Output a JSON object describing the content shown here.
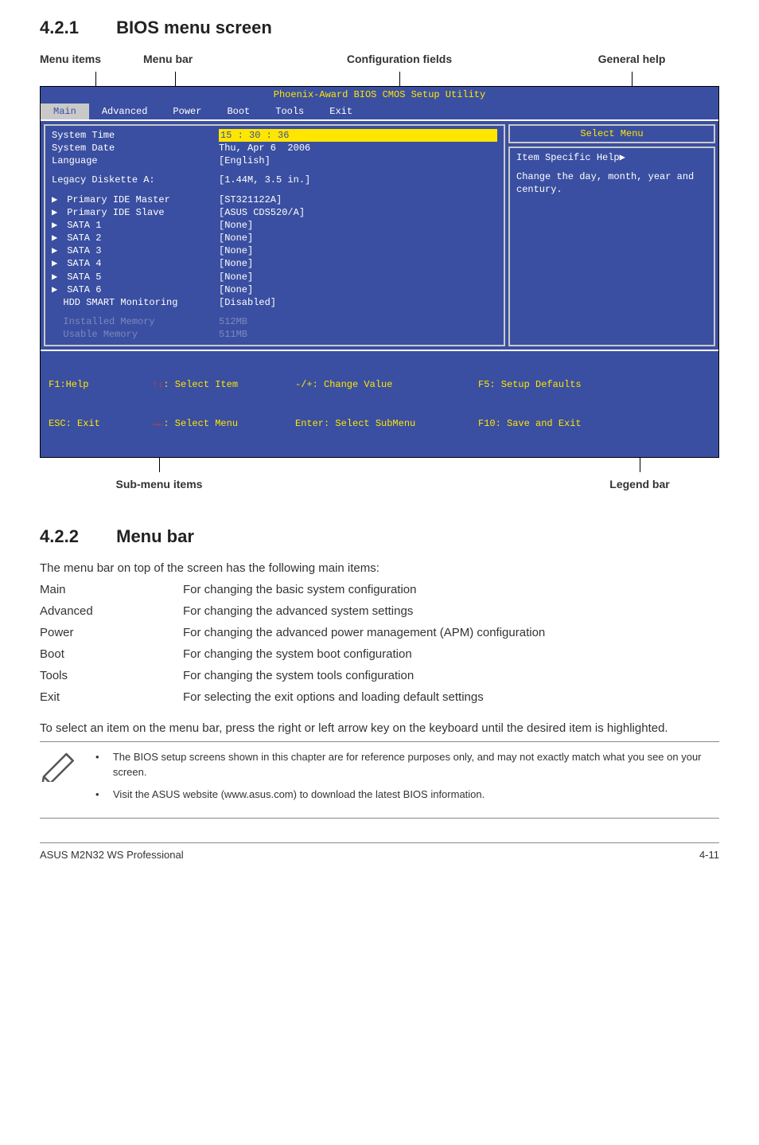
{
  "section_421": {
    "num": "4.2.1",
    "title": "BIOS menu screen"
  },
  "anno": {
    "top": {
      "menu_items": "Menu items",
      "menu_bar": "Menu bar",
      "config_fields": "Configuration fields",
      "general_help": "General help"
    },
    "bottom": {
      "sub_menu": "Sub-menu items",
      "legend": "Legend bar"
    }
  },
  "bios": {
    "title": "Phoenix-Award BIOS CMOS Setup Utility",
    "tabs": [
      "Main",
      "Advanced",
      "Power",
      "Boot",
      "Tools",
      "Exit"
    ],
    "active_tab": "Main",
    "right_title": "Select Menu",
    "right_help_label": "Item Specific Help",
    "right_help_text": "Change the day, month, year and century.",
    "fields": {
      "system_time": {
        "label": "System Time",
        "value": "15 : 30 : 36"
      },
      "system_date": {
        "label": "System Date",
        "value": "Thu, Apr 6  2006"
      },
      "language": {
        "label": "Language",
        "value": "[English]"
      },
      "legacy_diskette": {
        "label": "Legacy Diskette A:",
        "value": "[1.44M, 3.5 in.]"
      },
      "pri_master": {
        "label": "Primary IDE Master",
        "value": "[ST321122A]"
      },
      "pri_slave": {
        "label": "Primary IDE Slave",
        "value": "[ASUS CDS520/A]"
      },
      "sata1": {
        "label": "SATA 1",
        "value": "[None]"
      },
      "sata2": {
        "label": "SATA 2",
        "value": "[None]"
      },
      "sata3": {
        "label": "SATA 3",
        "value": "[None]"
      },
      "sata4": {
        "label": "SATA 4",
        "value": "[None]"
      },
      "sata5": {
        "label": "SATA 5",
        "value": "[None]"
      },
      "sata6": {
        "label": "SATA 6",
        "value": "[None]"
      },
      "hdd_smart": {
        "label": "HDD SMART Monitoring",
        "value": "[Disabled]"
      },
      "installed_mem": {
        "label": "Installed Memory",
        "value": "512MB"
      },
      "usable_mem": {
        "label": "Usable Memory",
        "value": "511MB"
      }
    },
    "footer": {
      "f1": "F1:Help",
      "esc": "ESC: Exit",
      "sel_item": ": Select Item",
      "sel_menu": ": Select Menu",
      "change": "-/+: Change Value",
      "enter": "Enter: Select SubMenu",
      "f5": "F5: Setup Defaults",
      "f10": "F10: Save and Exit"
    }
  },
  "section_422": {
    "num": "4.2.2",
    "title": "Menu bar",
    "intro": "The menu bar on top of the screen has the following main items:",
    "rows": [
      {
        "label": "Main",
        "val": "For changing the basic system configuration"
      },
      {
        "label": "Advanced",
        "val": "For changing the advanced system settings"
      },
      {
        "label": "Power",
        "val": "For changing the advanced power management (APM) configuration"
      },
      {
        "label": "Boot",
        "val": "For changing the system boot configuration"
      },
      {
        "label": "Tools",
        "val": "For changing the system tools configuration"
      },
      {
        "label": "Exit",
        "val": "For selecting the exit options and loading default settings"
      }
    ],
    "outro": "To select an item on the menu bar, press the right or left arrow key on the keyboard until the desired item is highlighted."
  },
  "notes": {
    "n1": "The BIOS setup screens shown in this chapter are for reference purposes only, and may not exactly match what you see on your screen.",
    "n2": "Visit the ASUS website (www.asus.com) to download the latest BIOS information."
  },
  "footer": {
    "left": "ASUS M2N32 WS Professional",
    "right": "4-11"
  }
}
